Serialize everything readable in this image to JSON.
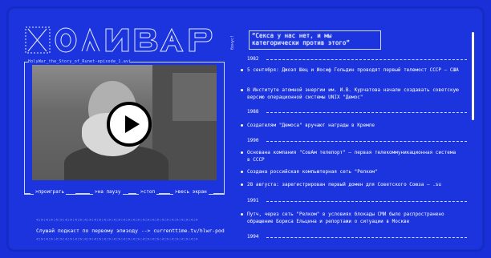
{
  "logo": {
    "text": "ХОЛИВАР"
  },
  "player": {
    "filename": "HolyWar_the_Story_of_Runet-episode_1.avi",
    "controls": {
      "play": ">проиграть",
      "pause": ">на паузу",
      "stop": ">стоп",
      "fullscreen": ">весь экран"
    }
  },
  "podcast": {
    "ascii_top": "<:>:<:>:<:>:<:>:<:>:<:>:<:>:<:>:<:>:<:>:<:>:<:>:<:>:<:>:<:>:<:>:<:>",
    "text": "Слушай подкаст по первому эпизоду --> currenttime.tv/hlwr-pod",
    "ascii_bottom": "<:>:<:>:<:>:<:>:<:>:<:>:<:>:<:>:<:>:<:>:<:>:<:>:<:>:<:>:<:>:<:>:<:>"
  },
  "bonus": {
    "label": "бонус!",
    "quote": "“Секса у нас нет, и мы категорически против этого”"
  },
  "timeline": [
    {
      "year": "1982",
      "events": [
        "5 сентября: Джоэл Шец и Иосиф Гольдин проводят первый телемост СССР – США",
        "В Институте атомной энергии им. И.В. Курчатова начали создавать советскую версию операционной системы UNIX \"Демос\""
      ]
    },
    {
      "year": "1988",
      "events": [
        "Создателям \"Демоса\" вручают награды в Кремле"
      ]
    },
    {
      "year": "1990",
      "events": [
        "Основана компания \"СовАм телепорт\" – первая телекоммуникационная система в СССР",
        "Создана российская компьютерная сеть \"Релком\"",
        "28 августа: зарегистрирован первый домен для Советского Союза – .su"
      ]
    },
    {
      "year": "1991",
      "events": [
        "Путч, через сеть \"Релком\" в условиях блокады СМИ было распространено обращение Бориса Ельцина и репортажи о ситуации в Москве"
      ]
    },
    {
      "year": "1994",
      "events": []
    }
  ]
}
